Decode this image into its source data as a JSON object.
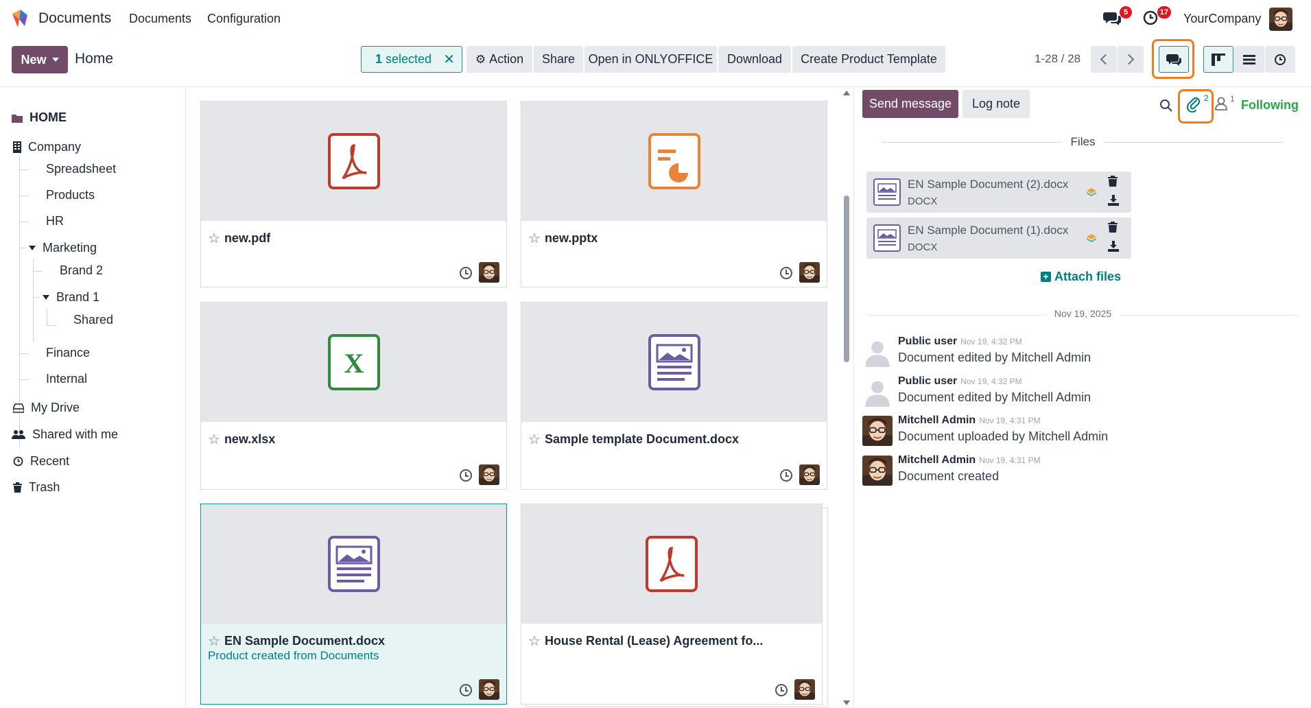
{
  "app": {
    "name": "Documents"
  },
  "topnav": {
    "menu": [
      "Documents",
      "Configuration"
    ],
    "messages_badge": "5",
    "activities_badge": "17",
    "company": "YourCompany"
  },
  "control": {
    "new_label": "New",
    "breadcrumb": "Home",
    "selected_count": "1",
    "selected_text": "selected",
    "toolbar": {
      "action": "Action",
      "share": "Share",
      "onlyoffice": "Open in ONLYOFFICE",
      "download": "Download",
      "product_template": "Create Product Template"
    },
    "pager": "1-28 / 28"
  },
  "sidebar": {
    "home": "HOME",
    "company": "Company",
    "spreadsheet": "Spreadsheet",
    "products": "Products",
    "hr": "HR",
    "marketing": "Marketing",
    "brand2": "Brand 2",
    "brand1": "Brand 1",
    "shared": "Shared",
    "finance": "Finance",
    "internal": "Internal",
    "my_drive": "My Drive",
    "shared_with_me": "Shared with me",
    "recent": "Recent",
    "trash": "Trash"
  },
  "documents": [
    {
      "name": "new.pdf",
      "type": "pdf",
      "subtitle": ""
    },
    {
      "name": "new.pptx",
      "type": "pptx",
      "subtitle": ""
    },
    {
      "name": "new.xlsx",
      "type": "xlsx",
      "subtitle": ""
    },
    {
      "name": "Sample template Document.docx",
      "type": "docx",
      "subtitle": ""
    },
    {
      "name": "EN Sample Document.docx",
      "type": "docx",
      "subtitle": "Product created from Documents",
      "selected": true
    },
    {
      "name": "House Rental (Lease) Agreement fo...",
      "type": "pdf",
      "subtitle": ""
    }
  ],
  "chatter": {
    "send_message": "Send message",
    "log_note": "Log note",
    "attachments_count": "2",
    "followers_count": "1",
    "following": "Following",
    "files_label": "Files",
    "files": [
      {
        "name": "EN Sample Document (2).docx",
        "ext": "DOCX"
      },
      {
        "name": "EN Sample Document (1).docx",
        "ext": "DOCX"
      }
    ],
    "attach_files": "Attach files",
    "date": "Nov 19, 2025",
    "messages": [
      {
        "author": "Public user",
        "time": "Nov 19, 4:32 PM",
        "body": "Document edited by Mitchell Admin",
        "avatar": "placeholder"
      },
      {
        "author": "Public user",
        "time": "Nov 19, 4:32 PM",
        "body": "Document edited by Mitchell Admin",
        "avatar": "placeholder"
      },
      {
        "author": "Mitchell Admin",
        "time": "Nov 19, 4:31 PM",
        "body": "Document uploaded by Mitchell Admin",
        "avatar": "mitchell"
      },
      {
        "author": "Mitchell Admin",
        "time": "Nov 19, 4:31 PM",
        "body": "Document created",
        "avatar": "mitchell"
      }
    ]
  },
  "colors": {
    "primary": "#714b67",
    "accent": "#017e84",
    "badge": "#e4151f",
    "highlight": "#f07d19",
    "following": "#28a745"
  }
}
